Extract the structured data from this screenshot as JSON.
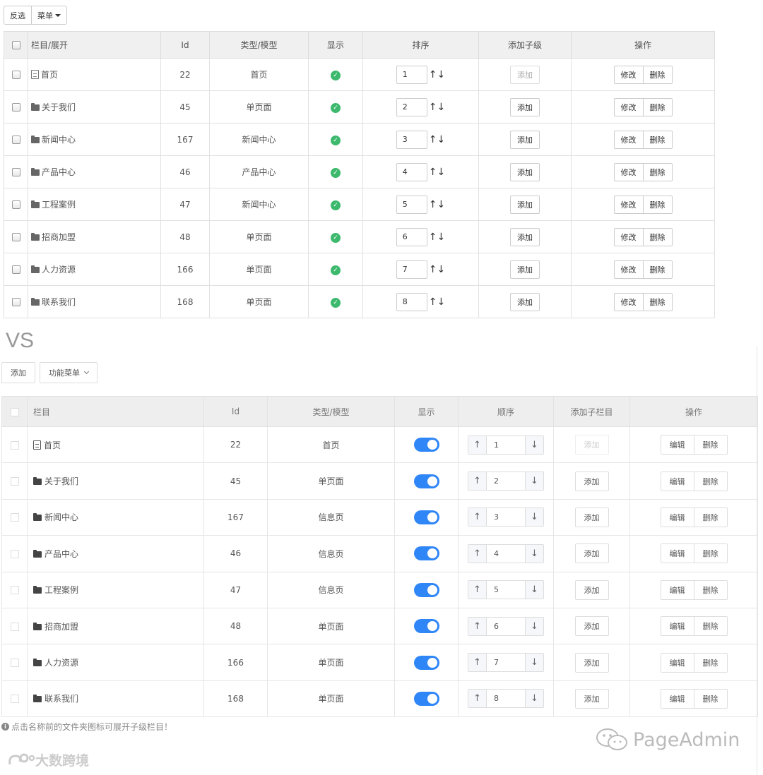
{
  "old": {
    "toolbar": {
      "invert_label": "反选",
      "menu_label": "菜单"
    },
    "headers": [
      "栏目/展开",
      "Id",
      "类型/模型",
      "显示",
      "排序",
      "添加子级",
      "操作"
    ],
    "rows": [
      {
        "name": "首页",
        "icon": "page-icon",
        "id": "22",
        "type": "首页",
        "order": "1",
        "add": "添加",
        "add_disabled": true,
        "edit": "修改",
        "del": "删除"
      },
      {
        "name": "关于我们",
        "icon": "folder-icon",
        "id": "45",
        "type": "单页面",
        "order": "2",
        "add": "添加",
        "edit": "修改",
        "del": "删除"
      },
      {
        "name": "新闻中心",
        "icon": "folder-icon",
        "id": "167",
        "type": "新闻中心",
        "order": "3",
        "add": "添加",
        "edit": "修改",
        "del": "删除"
      },
      {
        "name": "产品中心",
        "icon": "folder-icon",
        "id": "46",
        "type": "产品中心",
        "order": "4",
        "add": "添加",
        "edit": "修改",
        "del": "删除"
      },
      {
        "name": "工程案例",
        "icon": "folder-icon",
        "id": "47",
        "type": "新闻中心",
        "order": "5",
        "add": "添加",
        "edit": "修改",
        "del": "删除"
      },
      {
        "name": "招商加盟",
        "icon": "folder-icon",
        "id": "48",
        "type": "单页面",
        "order": "6",
        "add": "添加",
        "edit": "修改",
        "del": "删除"
      },
      {
        "name": "人力资源",
        "icon": "folder-icon",
        "id": "166",
        "type": "单页面",
        "order": "7",
        "add": "添加",
        "edit": "修改",
        "del": "删除"
      },
      {
        "name": "联系我们",
        "icon": "folder-icon",
        "id": "168",
        "type": "单页面",
        "order": "8",
        "add": "添加",
        "edit": "修改",
        "del": "删除"
      }
    ],
    "sort_arrows": "↑↓"
  },
  "vs_text": "VS",
  "new": {
    "toolbar": {
      "add_label": "添加",
      "menu_label": "功能菜单"
    },
    "headers": [
      "栏目",
      "Id",
      "类型/模型",
      "显示",
      "顺序",
      "添加子栏目",
      "操作"
    ],
    "rows": [
      {
        "name": "首页",
        "icon": "page-icon",
        "id": "22",
        "type": "首页",
        "shown": true,
        "order": "1",
        "add": "添加",
        "add_disabled": true,
        "edit": "编辑",
        "del": "删除"
      },
      {
        "name": "关于我们",
        "icon": "folder-icon",
        "id": "45",
        "type": "单页面",
        "shown": true,
        "order": "2",
        "add": "添加",
        "edit": "编辑",
        "del": "删除"
      },
      {
        "name": "新闻中心",
        "icon": "folder-icon",
        "id": "167",
        "type": "信息页",
        "shown": true,
        "order": "3",
        "add": "添加",
        "edit": "编辑",
        "del": "删除"
      },
      {
        "name": "产品中心",
        "icon": "folder-icon",
        "id": "46",
        "type": "信息页",
        "shown": true,
        "order": "4",
        "add": "添加",
        "edit": "编辑",
        "del": "删除"
      },
      {
        "name": "工程案例",
        "icon": "folder-icon",
        "id": "47",
        "type": "信息页",
        "shown": true,
        "order": "5",
        "add": "添加",
        "edit": "编辑",
        "del": "删除"
      },
      {
        "name": "招商加盟",
        "icon": "folder-icon",
        "id": "48",
        "type": "单页面",
        "shown": true,
        "order": "6",
        "add": "添加",
        "edit": "编辑",
        "del": "删除"
      },
      {
        "name": "人力资源",
        "icon": "folder-icon",
        "id": "166",
        "type": "单页面",
        "shown": true,
        "order": "7",
        "add": "添加",
        "edit": "编辑",
        "del": "删除"
      },
      {
        "name": "联系我们",
        "icon": "folder-icon",
        "id": "168",
        "type": "单页面",
        "shown": true,
        "order": "8",
        "add": "添加",
        "edit": "编辑",
        "del": "删除"
      }
    ],
    "up_arrow": "↑",
    "down_arrow": "↓",
    "hint": "点击名称前的文件夹图标可展开子级栏目！"
  },
  "watermark_right": "PageAdmin",
  "watermark_left": "大数跨境",
  "colors": {
    "toggle_on": "#2f86f6",
    "check_ok": "#3cb96c"
  }
}
